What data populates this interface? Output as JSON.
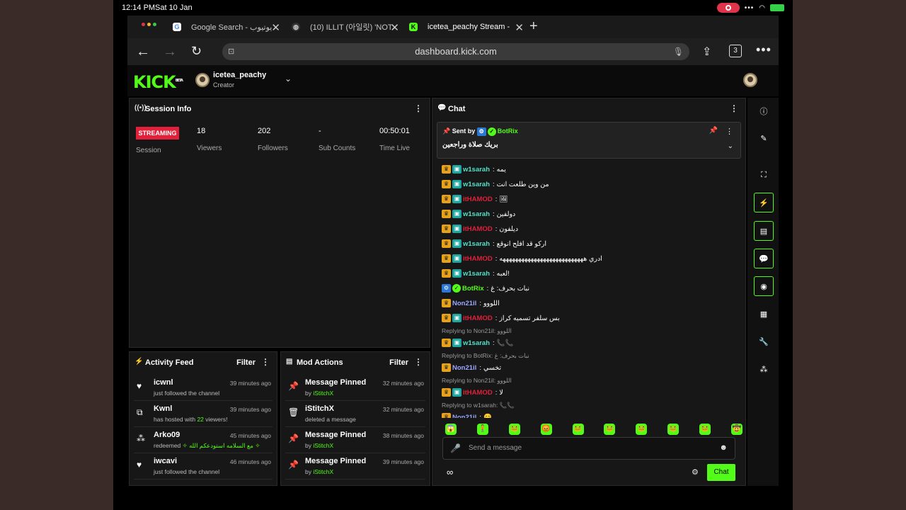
{
  "status": {
    "time": "12:14 PM",
    "date": "Sat 10 Jan",
    "battery": "charging"
  },
  "browser": {
    "tabs": [
      {
        "label": "Google Search - يوتيوب"
      },
      {
        "label": "(10) ILLIT (아일릿) 'NOT"
      },
      {
        "label": "icetea_peachy Stream -"
      }
    ],
    "url": "dashboard.kick.com",
    "tab_count": "3"
  },
  "kick": {
    "logo": "KICK",
    "beta": "BETA",
    "channel_name": "icetea_peachy",
    "channel_role": "Creator"
  },
  "session": {
    "title": "Session Info",
    "status_badge": "STREAMING",
    "session_label": "Session",
    "stats": [
      {
        "value": "18",
        "label": "Viewers"
      },
      {
        "value": "202",
        "label": "Followers"
      },
      {
        "value": "-",
        "label": "Sub Counts"
      },
      {
        "value": "00:50:01",
        "label": "Time Live"
      }
    ]
  },
  "activity": {
    "title": "Activity Feed",
    "filter": "Filter",
    "items": [
      {
        "icon": "heart-icon",
        "name": "icwnl",
        "desc": "just followed the channel",
        "time": "39 minutes ago"
      },
      {
        "icon": "host-icon",
        "name": "Kwnl",
        "desc_pre": "has hosted with ",
        "desc_num": "22",
        "desc_post": " viewers!",
        "time": "39 minutes ago"
      },
      {
        "icon": "redeem-icon",
        "name": "Arko09",
        "desc_pre": "redeemed ",
        "desc_num": "✧ مع السلامه استودعكم الله ✧",
        "desc_post": "",
        "time": "45 minutes ago"
      },
      {
        "icon": "heart-icon",
        "name": "iwcavi",
        "desc": "just followed the channel",
        "time": "46 minutes ago"
      }
    ]
  },
  "mod": {
    "title": "Mod Actions",
    "filter": "Filter",
    "items": [
      {
        "icon": "pin-icon",
        "name": "Message Pinned",
        "by": "by ",
        "who": "iStitchX",
        "time": "32 minutes ago"
      },
      {
        "icon": "trash-icon",
        "name": "iStitchX",
        "by": "deleted a message",
        "who": "",
        "time": "32 minutes ago"
      },
      {
        "icon": "pin-icon",
        "name": "Message Pinned",
        "by": "by ",
        "who": "iStitchX",
        "time": "38 minutes ago"
      },
      {
        "icon": "pin-icon",
        "name": "Message Pinned",
        "by": "by ",
        "who": "iStitchX",
        "time": "39 minutes ago"
      }
    ]
  },
  "chat": {
    "title": "Chat",
    "pinned": {
      "sent_by": "Sent by",
      "user": "BotRix",
      "message": "بريك صلاة وراجعين"
    },
    "messages": [
      {
        "type": "msg",
        "user": "w1sarah",
        "color": "teal",
        "badges": [
          "crown",
          "sub"
        ],
        "text": "يمه"
      },
      {
        "type": "msg",
        "user": "w1sarah",
        "color": "teal",
        "badges": [
          "crown",
          "sub"
        ],
        "text": "من وين طلعت انت"
      },
      {
        "type": "msg",
        "user": "itHAMOD",
        "color": "red",
        "badges": [
          "crown",
          "sub"
        ],
        "text": "🖼"
      },
      {
        "type": "msg",
        "user": "w1sarah",
        "color": "teal",
        "badges": [
          "crown",
          "sub"
        ],
        "text": "دولفين"
      },
      {
        "type": "msg",
        "user": "itHAMOD",
        "color": "red",
        "badges": [
          "crown",
          "sub"
        ],
        "text": "ديلفون"
      },
      {
        "type": "msg",
        "user": "w1sarah",
        "color": "teal",
        "badges": [
          "crown",
          "sub"
        ],
        "text": "اركو قد افلح انوقع"
      },
      {
        "type": "msg",
        "user": "itHAMOD",
        "color": "red",
        "badges": [
          "crown",
          "sub"
        ],
        "text": "ادري هههههههههههههههههههههههههههه"
      },
      {
        "type": "msg",
        "user": "w1sarah",
        "color": "teal",
        "badges": [
          "crown",
          "sub"
        ],
        "text": "لعبه!"
      },
      {
        "type": "msg",
        "user": "BotRix",
        "color": "lime",
        "badges": [
          "bot",
          "verified"
        ],
        "text": "نبات بحرف: غ"
      },
      {
        "type": "msg",
        "user": "Non21il",
        "color": "blue",
        "badges": [
          "crown"
        ],
        "text": "اللووو"
      },
      {
        "type": "msg",
        "user": "itHAMOD",
        "color": "red",
        "badges": [
          "crown",
          "sub"
        ],
        "text": "بس سلفر تسميه كراز"
      },
      {
        "type": "reply",
        "text": "Replying to Non21il: اللووو"
      },
      {
        "type": "msg",
        "user": "w1sarah",
        "color": "teal",
        "badges": [
          "crown",
          "sub"
        ],
        "text": "📞📞"
      },
      {
        "type": "reply",
        "text": "Replying to BotRix: نبات بحرف: غ"
      },
      {
        "type": "msg",
        "user": "Non21il",
        "color": "blue",
        "badges": [
          "crown"
        ],
        "text": "تخسي"
      },
      {
        "type": "reply",
        "text": "Replying to Non21il: اللووو"
      },
      {
        "type": "msg",
        "user": "itHAMOD",
        "color": "red",
        "badges": [
          "crown",
          "sub"
        ],
        "text": "لا"
      },
      {
        "type": "reply",
        "text": "Replying to w1sarah: 📞📞"
      },
      {
        "type": "msg",
        "user": "Non21il",
        "color": "blue",
        "badges": [
          "crown"
        ],
        "text": "😊"
      }
    ],
    "emotes": [
      "😱",
      "🧍",
      "🐸",
      "😡",
      "🐸",
      "🐸",
      "🐸",
      "🐸",
      "🐸",
      "🤠"
    ],
    "input_placeholder": "Send a message",
    "send_label": "Chat",
    "footer_symbol": "∞"
  },
  "rail": [
    "info-icon",
    "edit-icon",
    "fullscreen-icon",
    "bolt-icon",
    "notes-icon",
    "chat-icon",
    "broadcast-icon",
    "layout-icon",
    "wrench-icon",
    "apps-icon"
  ]
}
